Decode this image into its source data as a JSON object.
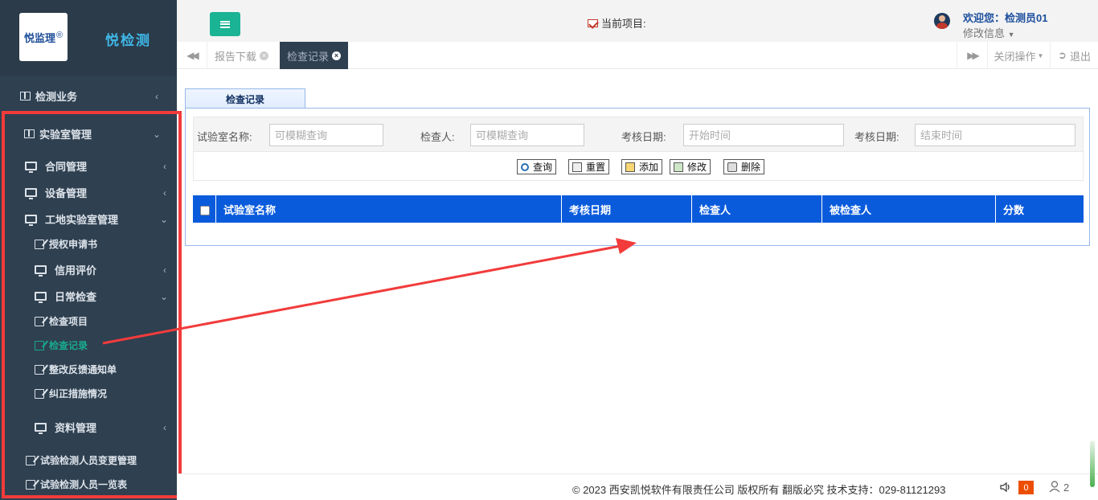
{
  "brand": {
    "logo_text": "悦监理",
    "logo_mark": "®",
    "app_name": "悦检测"
  },
  "header": {
    "project_label": "当前项目:",
    "welcome": "欢迎您：检测员01",
    "modify_info": "修改信息"
  },
  "tabs": {
    "items": [
      {
        "label": "报告下载",
        "active": false
      },
      {
        "label": "检查记录",
        "active": true
      }
    ],
    "close_ops": "关闭操作",
    "logout": "退出"
  },
  "sidebar": {
    "items": [
      {
        "label": "检测业务",
        "level": 0
      },
      {
        "label": "实验室管理",
        "level": 0
      },
      {
        "label": "合同管理",
        "level": 1
      },
      {
        "label": "设备管理",
        "level": 1
      },
      {
        "label": "工地实验室管理",
        "level": 1
      },
      {
        "label": "授权申请书",
        "level": 2
      },
      {
        "label": "信用评价",
        "level": 2
      },
      {
        "label": "日常检查",
        "level": 2
      },
      {
        "label": "检查项目",
        "level": 3
      },
      {
        "label": "检查记录",
        "level": 3,
        "active": true
      },
      {
        "label": "整改反馈通知单",
        "level": 3
      },
      {
        "label": "纠正措施情况",
        "level": 3
      },
      {
        "label": "资料管理",
        "level": 2
      },
      {
        "label": "试验检测人员变更管理",
        "level": 1
      },
      {
        "label": "试验检测人员一览表",
        "level": 1
      }
    ]
  },
  "panel": {
    "title": "检查记录",
    "search": {
      "lab_name_label": "试验室名称:",
      "lab_name_placeholder": "可模糊查询",
      "inspector_label": "检查人:",
      "inspector_placeholder": "可模糊查询",
      "date_start_label": "考核日期:",
      "date_start_placeholder": "开始时间",
      "date_end_label": "考核日期:",
      "date_end_placeholder": "结束时间"
    },
    "buttons": {
      "query": "查询",
      "reset": "重置",
      "add": "添加",
      "edit": "修改",
      "delete": "删除"
    },
    "columns": [
      "试验室名称",
      "考核日期",
      "检查人",
      "被检查人",
      "分数"
    ]
  },
  "footer": {
    "copyright": "© 2023 西安凯悦软件有限责任公司 版权所有 翻版必究 技术支持：029-81121293",
    "notification_count": "0",
    "online_users": "2"
  },
  "colors": {
    "sidebar_bg": "#2f4050",
    "accent_green": "#1ab394",
    "grid_header": "#0a5bdc",
    "annotation_red": "#f23b3b",
    "badge_orange": "#ec4e00"
  }
}
